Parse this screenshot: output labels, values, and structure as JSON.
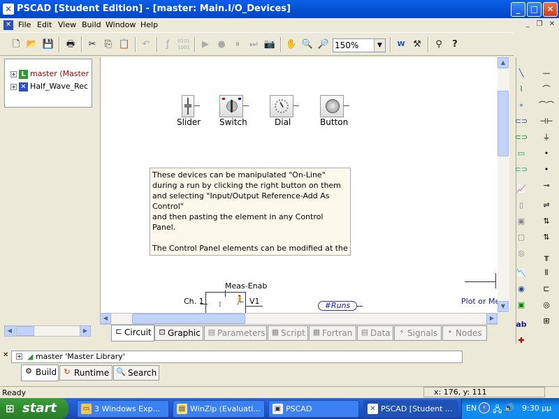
{
  "window": {
    "title": "PSCAD [Student Edition] - [master: Main.I/O_Devices]",
    "controls": [
      "_",
      "□",
      "✕"
    ]
  },
  "menubar": {
    "items": [
      "File",
      "Edit",
      "View",
      "Build",
      "Window",
      "Help"
    ],
    "mdi_controls": [
      "_",
      "❐",
      "✕"
    ]
  },
  "toolbar": {
    "zoom_value": "150%"
  },
  "tree": {
    "nodes": [
      {
        "label": "master (Master L",
        "icon_letter": "L"
      },
      {
        "label": "Half_Wave_Rec"
      }
    ]
  },
  "canvas": {
    "devices": [
      {
        "label": "Slider"
      },
      {
        "label": "Switch"
      },
      {
        "label": "Dial"
      },
      {
        "label": "Button"
      }
    ],
    "note": {
      "lines": [
        "These devices can be manipulated \"On-Line\"",
        "during a run by clicking the right button on them",
        "and selecting \"Input/Output Reference-Add As",
        "Control\"",
        "and then pasting the element in any Control Panel.",
        "",
        "The Control Panel elements can be modified at the"
      ]
    },
    "bottom_labels": {
      "meas": "Meas-Enab",
      "ch1": "Ch. 1",
      "v1": "V1",
      "runs": "#Runs",
      "plot": "Plot or Me"
    }
  },
  "tabs": [
    {
      "label": "Circuit",
      "active": true
    },
    {
      "label": "Graphic",
      "active": false,
      "enabled": true
    },
    {
      "label": "Parameters",
      "active": false,
      "enabled": false
    },
    {
      "label": "Script",
      "active": false,
      "enabled": false
    },
    {
      "label": "Fortran",
      "active": false,
      "enabled": false
    },
    {
      "label": "Data",
      "active": false,
      "enabled": false
    },
    {
      "label": "Signals",
      "active": false,
      "enabled": false
    },
    {
      "label": "Nodes",
      "active": false,
      "enabled": false
    }
  ],
  "output": {
    "line": "master 'Master Library'"
  },
  "bottom_tabs": [
    {
      "label": "Build"
    },
    {
      "label": "Runtime"
    },
    {
      "label": "Search"
    }
  ],
  "status": {
    "left": "Ready",
    "coords": "x: 176, y: 111"
  },
  "taskbar": {
    "start": "start",
    "tasks": [
      {
        "label": "3 Windows Exp...",
        "icon": "folder-icon"
      },
      {
        "label": "WinZip (Evaluati...",
        "icon": "winzip-icon"
      },
      {
        "label": "PSCAD",
        "icon": "pscad-icon"
      },
      {
        "label": "PSCAD [Student ...",
        "icon": "pscad-icon"
      }
    ],
    "lang": "EN",
    "clock": "9:30 μμ"
  }
}
